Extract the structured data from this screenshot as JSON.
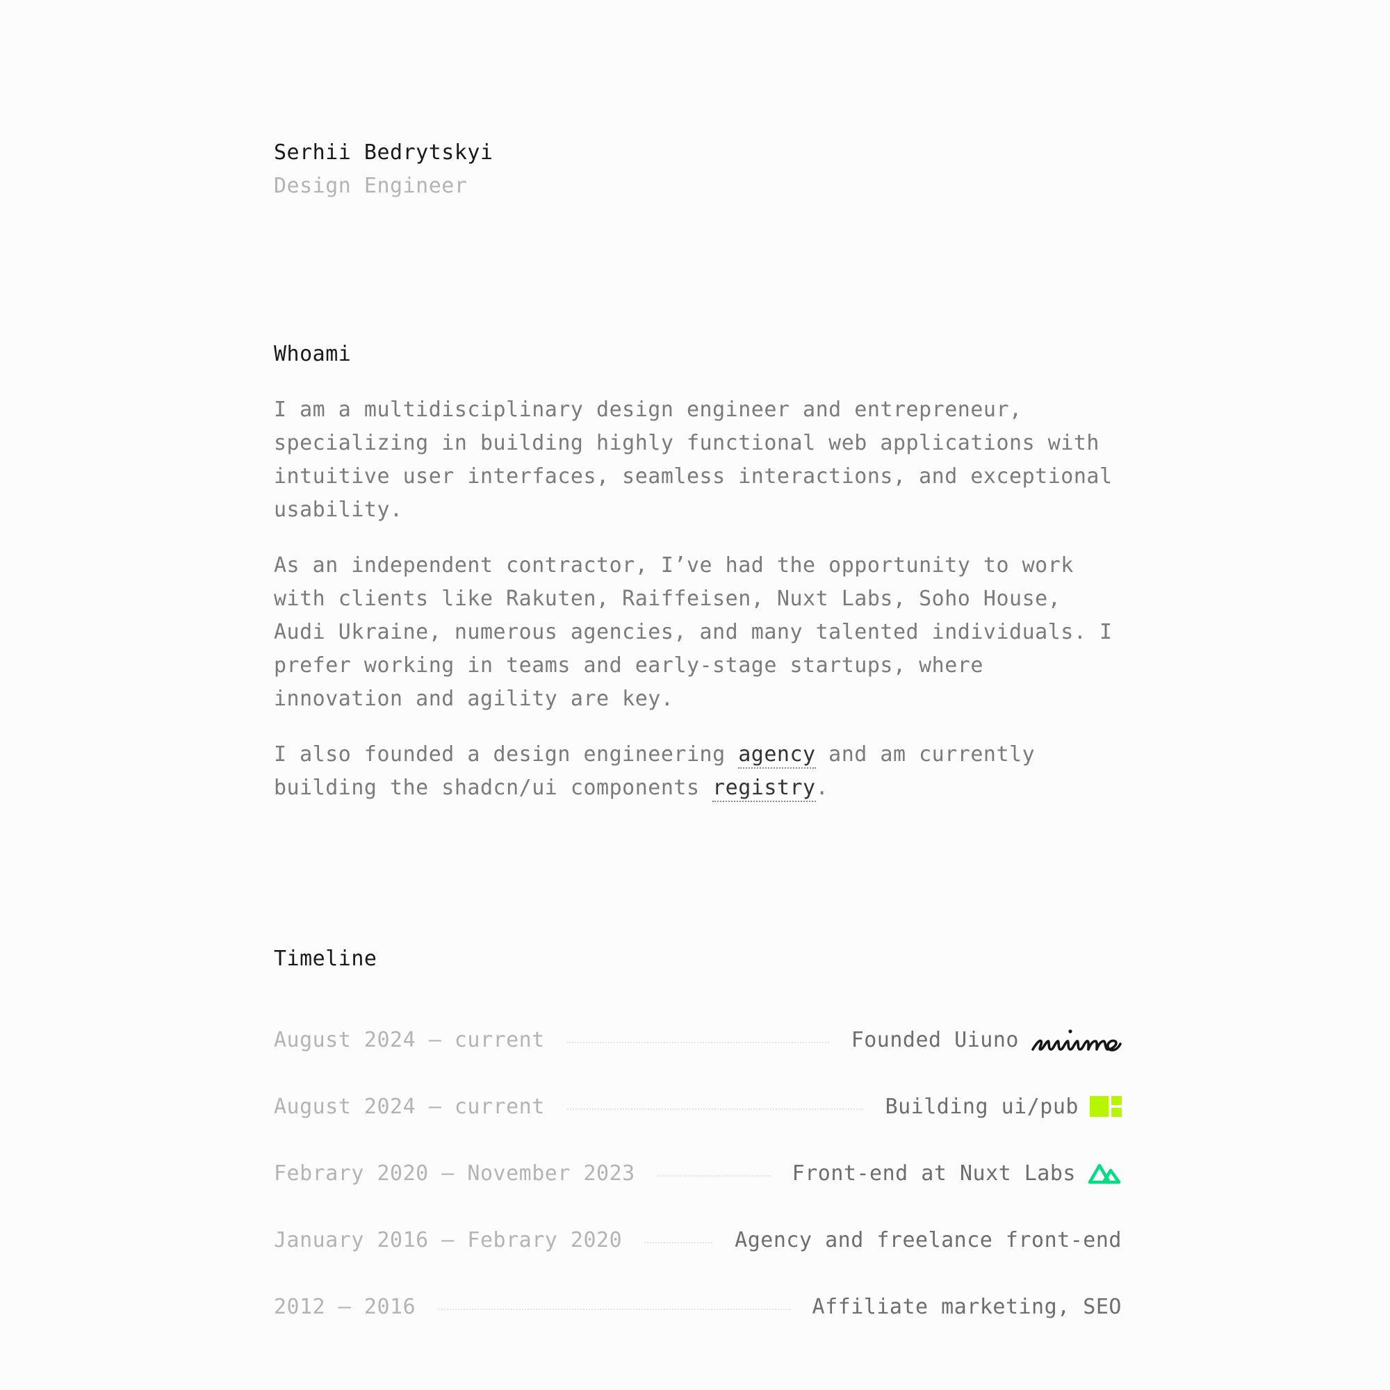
{
  "header": {
    "name": "Serhii Bedrytskyi",
    "role": "Design Engineer"
  },
  "whoami": {
    "title": "Whoami",
    "paragraph1": "I am a multidisciplinary design engineer and entrepreneur, specializing in building highly functional web applications with intuitive user interfaces, seamless interactions, and exceptional usability.",
    "paragraph2": "As an independent contractor, I’ve had the opportunity to work with clients like Rakuten, Raiffeisen, Nuxt Labs, Soho House, Audi Ukraine, numerous agencies, and many talented individuals. I prefer working in teams and early-stage startups, where innovation and agility are key.",
    "paragraph3_start": "I also founded a design engineering ",
    "agency_link": "agency",
    "paragraph3_middle": " and am currently building the shadcn/ui components ",
    "registry_link": "registry",
    "paragraph3_end": "."
  },
  "timeline": {
    "title": "Timeline",
    "items": [
      {
        "date": "August 2024 – current",
        "label": "Founded Uiuno",
        "logo": "uiuno-wordmark-icon"
      },
      {
        "date": "August 2024 – current",
        "label": "Building ui/pub",
        "logo": "uipub-blocks-icon"
      },
      {
        "date": "Febrary 2020 – November 2023",
        "label": "Front-end at Nuxt Labs",
        "logo": "nuxt-logo-icon"
      },
      {
        "date": "January 2016 – Febrary 2020",
        "label": "Agency and freelance front-end",
        "logo": ""
      },
      {
        "date": "2012 – 2016",
        "label": "Affiliate marketing, SEO",
        "logo": ""
      }
    ]
  },
  "colors": {
    "background": "#fcfcfc",
    "heading": "#1a1a1a",
    "body": "#7b7b7b",
    "muted": "#b4b4b4",
    "uipub_accent": "#b8f500",
    "nuxt_green": "#00dc82"
  }
}
